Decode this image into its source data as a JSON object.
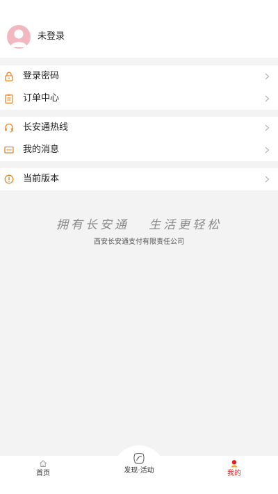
{
  "profile": {
    "name": "未登录",
    "avatar_icon": "user-avatar-icon"
  },
  "menu": {
    "group1": [
      {
        "label": "登录密码",
        "icon": "lock-icon"
      },
      {
        "label": "订单中心",
        "icon": "clipboard-icon"
      }
    ],
    "group2": [
      {
        "label": "长安通热线",
        "icon": "headset-icon"
      },
      {
        "label": "我的消息",
        "icon": "message-icon"
      }
    ],
    "group3": [
      {
        "label": "当前版本",
        "icon": "info-icon"
      }
    ]
  },
  "footer": {
    "slogan": "拥有长安通   生活更轻松",
    "company": "西安长安通支付有限责任公司"
  },
  "tabbar": {
    "home": "首页",
    "discover": "发现·活动",
    "mine": "我的"
  },
  "colors": {
    "accent": "#e8862a",
    "active_tab": "#e02020",
    "background": "#f3f3f3"
  }
}
